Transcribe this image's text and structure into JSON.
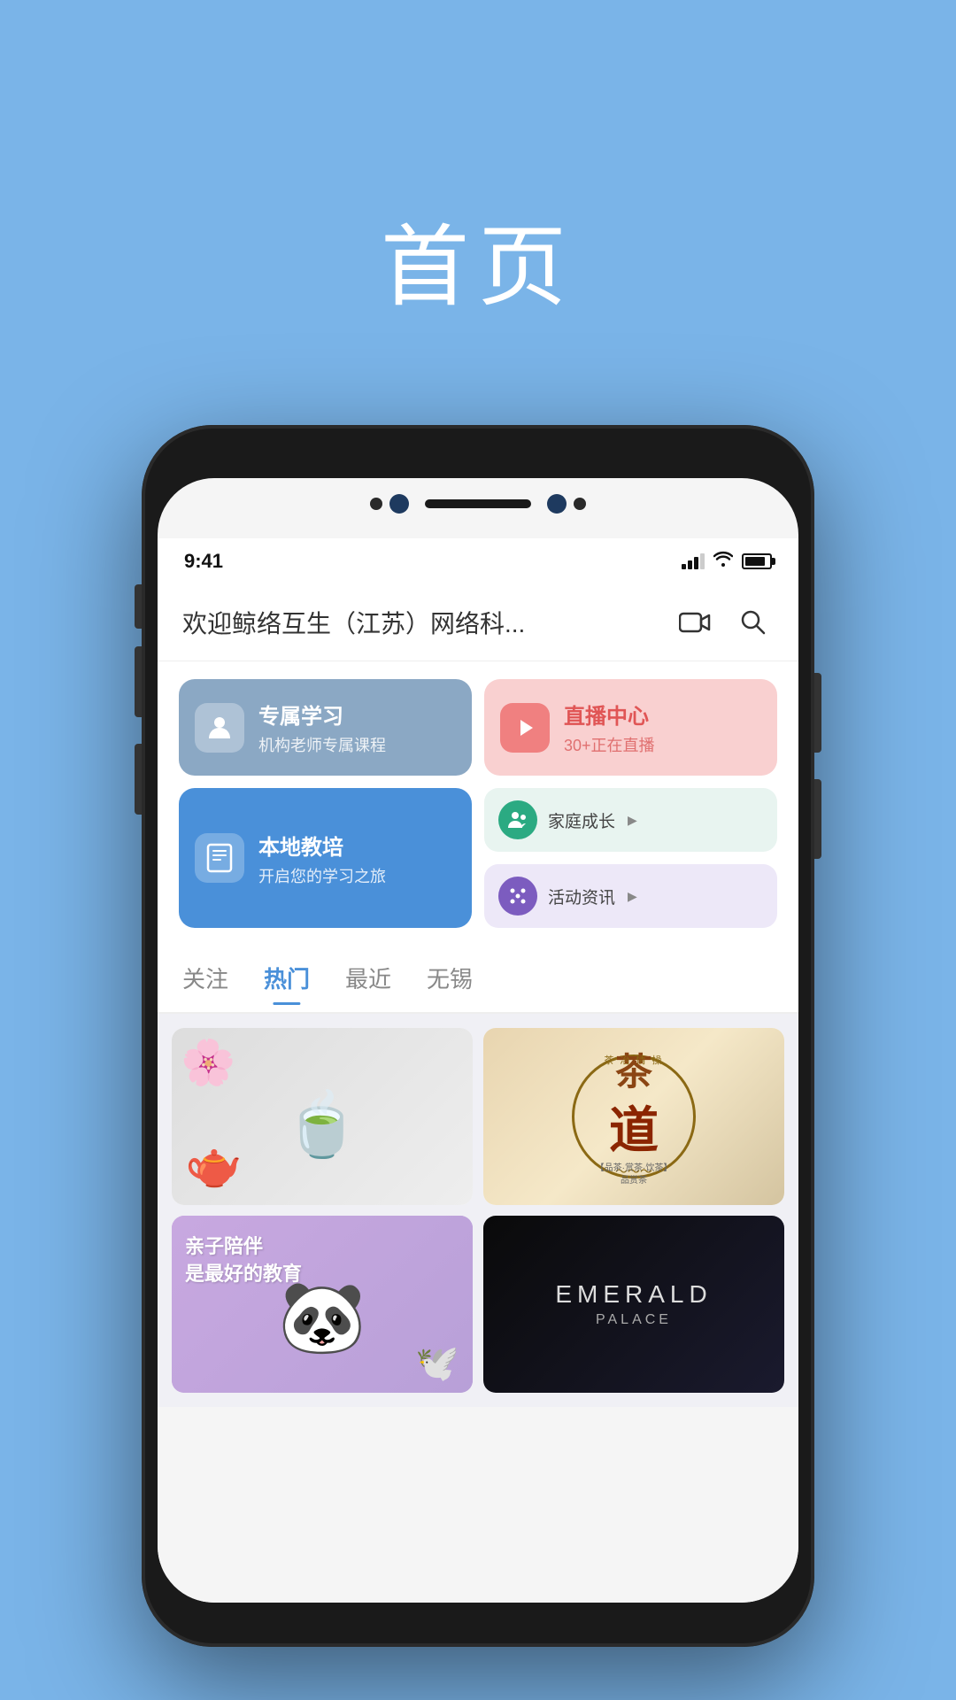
{
  "background_color": "#7ab4e8",
  "page_title": "首页",
  "status_bar": {
    "time": "9:41",
    "signal": 3,
    "wifi": true,
    "battery": 85
  },
  "header": {
    "title": "欢迎鲸络互生（江苏）网络科...",
    "video_icon": "video-camera",
    "search_icon": "search"
  },
  "quick_buttons": [
    {
      "id": "study",
      "title": "专属学习",
      "subtitle": "机构老师专属课程",
      "icon": "person-study",
      "color": "#8ba8c4"
    },
    {
      "id": "live",
      "title": "直播中心",
      "subtitle": "30+正在直播",
      "icon": "play-circle",
      "color": "#f9d0d0"
    },
    {
      "id": "local",
      "title": "本地教培",
      "subtitle": "开启您的学习之旅",
      "icon": "document",
      "color": "#4a90d9"
    }
  ],
  "mini_buttons": [
    {
      "id": "family",
      "title": "家庭成长",
      "arrow": "▶",
      "color": "#e8f4f0",
      "icon_color": "#2baa82"
    },
    {
      "id": "activity",
      "title": "活动资讯",
      "arrow": "▶",
      "color": "#ede8f8",
      "icon_color": "#7c5cbf"
    }
  ],
  "tabs": [
    {
      "id": "follow",
      "label": "关注",
      "active": false
    },
    {
      "id": "hot",
      "label": "热门",
      "active": true
    },
    {
      "id": "recent",
      "label": "最近",
      "active": false
    },
    {
      "id": "wuxi",
      "label": "无锡",
      "active": false
    }
  ],
  "content_cards": [
    {
      "id": "tea-items",
      "type": "tea-items",
      "wide": false
    },
    {
      "id": "tea-ceremony",
      "type": "tea",
      "wide": false
    },
    {
      "id": "children-edu",
      "type": "children",
      "text_line1": "亲子陪伴",
      "text_line2": "是最好的教育",
      "wide": false
    },
    {
      "id": "emerald",
      "type": "emerald",
      "title": "EMERALD",
      "subtitle": "PALACE",
      "wide": false
    }
  ]
}
